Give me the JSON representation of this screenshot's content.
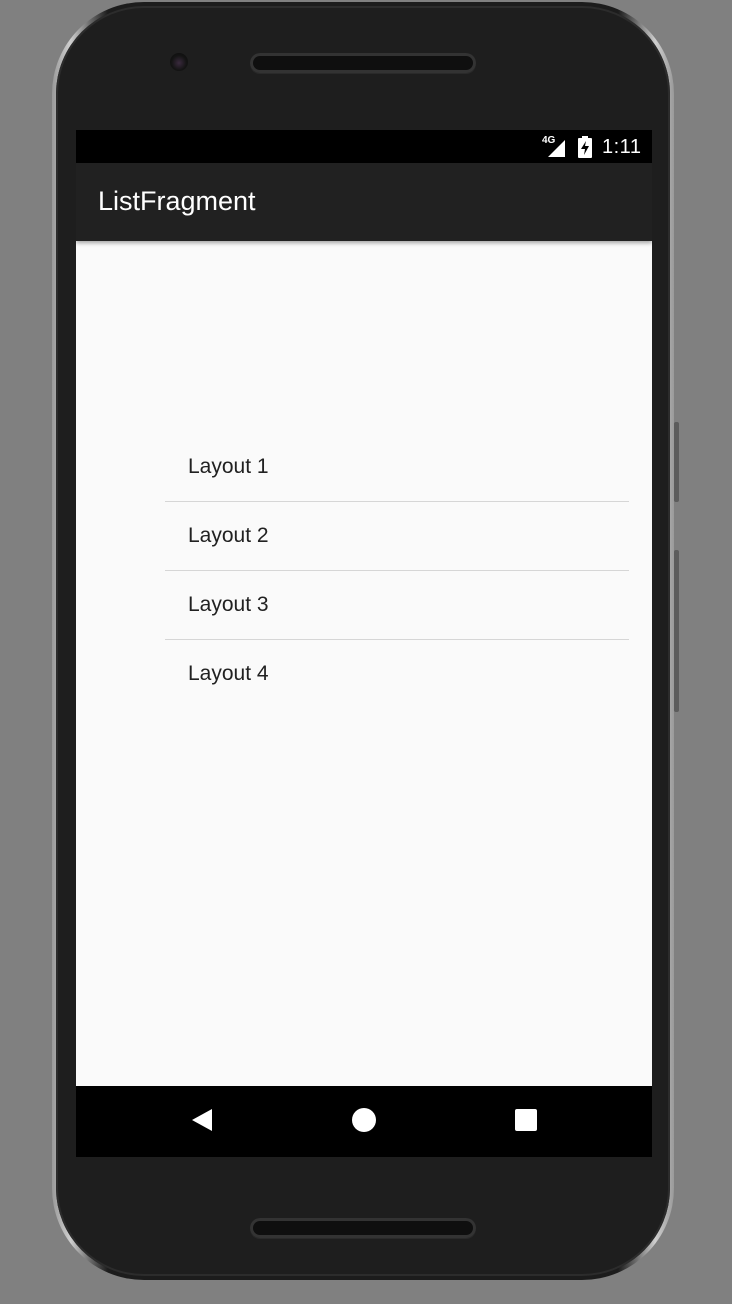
{
  "status_bar": {
    "network_label": "4G",
    "time": "1:11",
    "icons": [
      "cellular-signal-icon",
      "battery-charging-icon"
    ]
  },
  "app_bar": {
    "title": "ListFragment"
  },
  "list": {
    "items": [
      {
        "label": "Layout 1"
      },
      {
        "label": "Layout 2"
      },
      {
        "label": "Layout 3"
      },
      {
        "label": "Layout 4"
      }
    ]
  },
  "nav_bar": {
    "icons": [
      "back-icon",
      "home-icon",
      "recents-icon"
    ]
  },
  "colors": {
    "app_bar": "#212121",
    "content_background": "#fafafa",
    "divider": "#d6d6d6",
    "text_primary": "#212121",
    "bezel": "#1e1e1e",
    "backdrop": "#808080"
  }
}
